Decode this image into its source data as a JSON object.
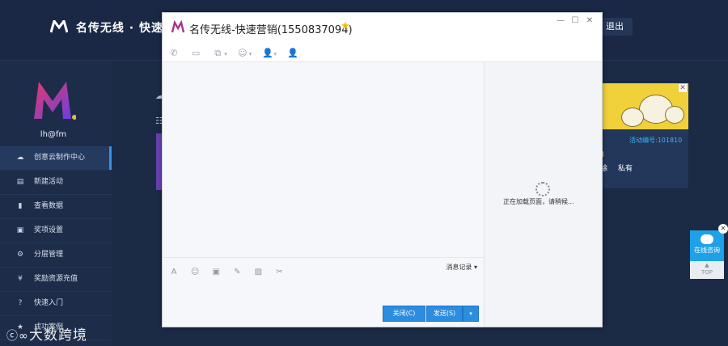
{
  "app": {
    "brand_text": "名传无线 · 快速营销",
    "logout_label": "退出"
  },
  "sidebar": {
    "username": "lh@fm",
    "items": [
      {
        "label": "创意云制作中心",
        "icon": "cloud-upload-icon",
        "active": true
      },
      {
        "label": "新建活动",
        "icon": "document-icon"
      },
      {
        "label": "查看数据",
        "icon": "book-icon"
      },
      {
        "label": "奖项设置",
        "icon": "gift-icon"
      },
      {
        "label": "分层管理",
        "icon": "gear-icon"
      },
      {
        "label": "奖励资源充值",
        "icon": "yen-icon"
      },
      {
        "label": "快速入门",
        "icon": "question-icon"
      },
      {
        "label": "成功案例",
        "icon": "star-icon"
      }
    ]
  },
  "card": {
    "activity_id": "活动编号:101810",
    "action_delete": "除",
    "action_private": "私有"
  },
  "float": {
    "consult_label": "在线咨询",
    "top_label": "TOP"
  },
  "watermark": {
    "text": "大数跨境"
  },
  "chat": {
    "title": "名传无线-快速营销(1550837094)",
    "message_history_label": "消息记录",
    "loading_text": "正在加载页面，请稍候...",
    "close_button": "关闭(C)",
    "send_button": "发送(S)"
  },
  "colors": {
    "background": "#1b2a45",
    "accent": "#2c8de0",
    "highlight": "#3fb4ff"
  }
}
